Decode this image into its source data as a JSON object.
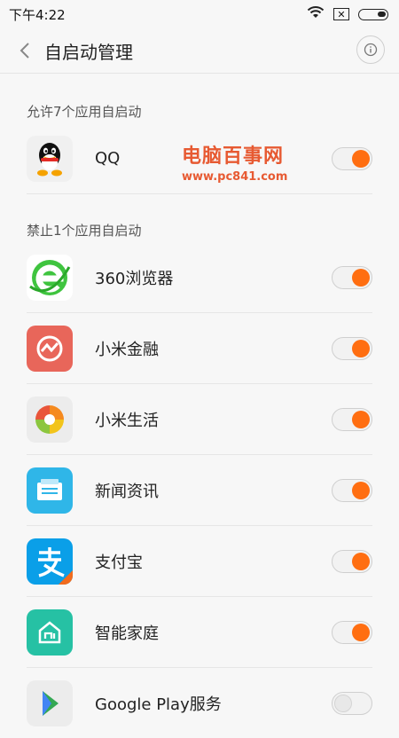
{
  "status_bar": {
    "time": "下午4:22",
    "icons": [
      "wifi-icon",
      "no-sim-icon",
      "battery-icon"
    ]
  },
  "header": {
    "title": "自启动管理",
    "back_icon": "chevron-left-icon",
    "info_icon": "info-icon"
  },
  "watermark": {
    "line1": "电脑百事网",
    "line2": "www.pc841.com"
  },
  "allowed_section": {
    "title": "允许7个应用自启动",
    "apps": [
      {
        "name": "QQ",
        "icon": "qq-penguin-icon",
        "enabled": true
      }
    ]
  },
  "blocked_section": {
    "title": "禁止1个应用自启动",
    "apps": [
      {
        "name": "360浏览器",
        "icon": "360-browser-icon",
        "enabled": true
      },
      {
        "name": "小米金融",
        "icon": "mi-finance-icon",
        "enabled": true,
        "color": "#e8665a"
      },
      {
        "name": "小米生活",
        "icon": "mi-life-icon",
        "enabled": true
      },
      {
        "name": "新闻资讯",
        "icon": "news-icon",
        "enabled": true,
        "color": "#2fb6e8"
      },
      {
        "name": "支付宝",
        "icon": "alipay-icon",
        "enabled": true,
        "color": "#0a9fe8"
      },
      {
        "name": "智能家庭",
        "icon": "smart-home-icon",
        "enabled": true,
        "color": "#26c1a4"
      },
      {
        "name": "Google Play服务",
        "icon": "google-play-services-icon",
        "enabled": false
      }
    ]
  },
  "colors": {
    "toggle_on": "#ff6e11",
    "background": "#f7f7f7",
    "watermark": "#e75a32"
  }
}
